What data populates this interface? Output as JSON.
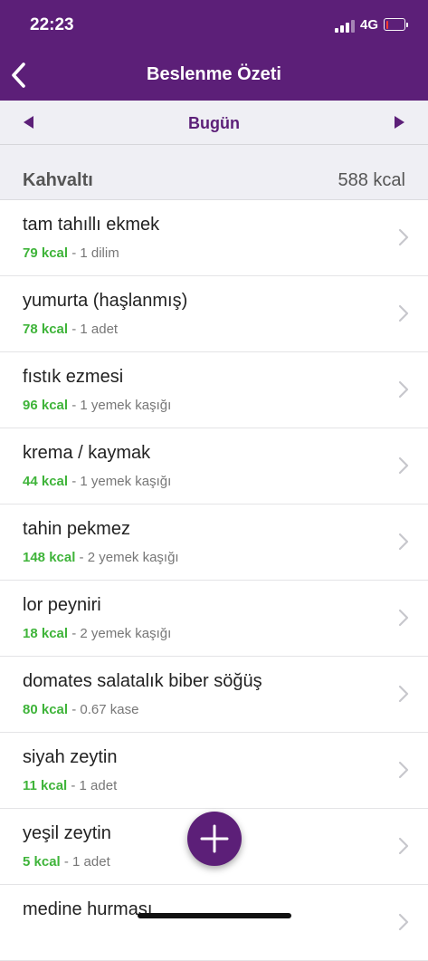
{
  "status_bar": {
    "time": "22:23",
    "network": "4G",
    "battery_level": 0.15,
    "icons": [
      "signal-icon",
      "battery-icon"
    ]
  },
  "nav": {
    "title": "Beslenme Özeti",
    "back_icon": "chevron-left-icon"
  },
  "date_bar": {
    "label": "Bugün",
    "prev_icon": "triangle-left-icon",
    "next_icon": "triangle-right-icon"
  },
  "section": {
    "title": "Kahvaltı",
    "total": "588 kcal"
  },
  "items": [
    {
      "name": "tam tahıllı ekmek",
      "kcal": "79 kcal",
      "portion": " - 1 dilim"
    },
    {
      "name": "yumurta (haşlanmış)",
      "kcal": "78 kcal",
      "portion": " - 1 adet"
    },
    {
      "name": "fıstık ezmesi",
      "kcal": "96 kcal",
      "portion": " - 1 yemek kaşığı"
    },
    {
      "name": "krema / kaymak",
      "kcal": "44 kcal",
      "portion": " - 1 yemek kaşığı"
    },
    {
      "name": "tahin pekmez",
      "kcal": "148 kcal",
      "portion": " - 2 yemek kaşığı"
    },
    {
      "name": "lor peyniri",
      "kcal": "18 kcal",
      "portion": " - 2 yemek kaşığı"
    },
    {
      "name": "domates salatalık biber söğüş",
      "kcal": "80 kcal",
      "portion": " - 0.67 kase"
    },
    {
      "name": "siyah zeytin",
      "kcal": "11 kcal",
      "portion": " - 1 adet"
    },
    {
      "name": "yeşil zeytin",
      "kcal": "5 kcal",
      "portion": " - 1 adet"
    },
    {
      "name": "medine hurması",
      "kcal": "",
      "portion": ""
    }
  ],
  "fab_icon": "plus-icon",
  "colors": {
    "brand": "#5c1f78",
    "kcal_green": "#3fb43a",
    "section_bg": "#efeff4"
  }
}
